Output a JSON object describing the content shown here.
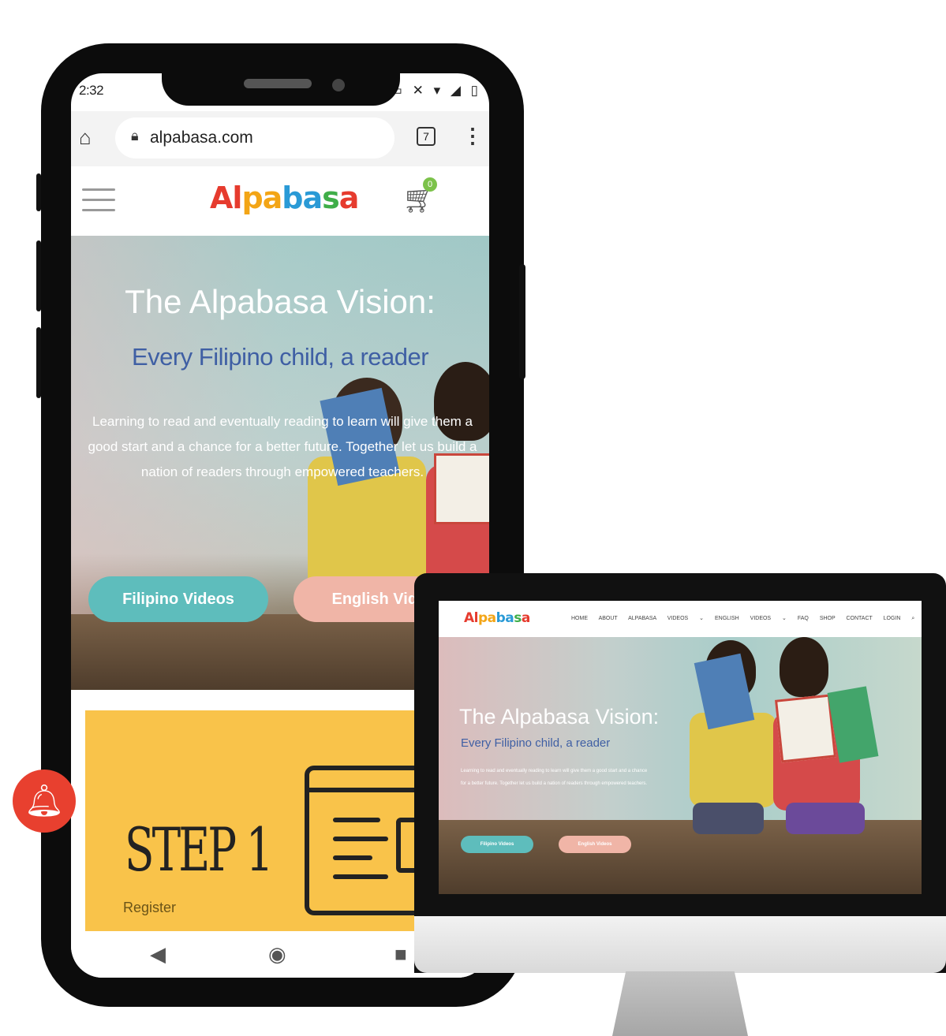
{
  "phone": {
    "status": {
      "time": "2:32",
      "icons": "⊖ ▭ ✕ ▾ ◢ ▯"
    },
    "browser": {
      "url": "alpabasa.com",
      "tab_count": "7"
    },
    "site": {
      "logo": [
        "Al",
        "pa",
        "ba",
        "s",
        "a"
      ],
      "cart_count": "0"
    },
    "hero": {
      "title": "The Alpabasa Vision:",
      "subtitle": "Every Filipino child, a reader",
      "body": "Learning to read and eventually reading to learn will give them a good start and a chance for a better future. Together let us build a nation of readers through empowered teachers.",
      "btn_filipino": "Filipino Videos",
      "btn_english": "English Videos"
    },
    "step": {
      "title": "STEP 1",
      "caption": "Register"
    }
  },
  "desktop": {
    "logo": "Alpabasa",
    "nav": [
      "HOME",
      "ABOUT",
      "ALPABASA VIDEOS ⌄",
      "ENGLISH VIDEOS ⌄",
      "FAQ",
      "SHOP",
      "CONTACT",
      "LOGIN"
    ],
    "hero": {
      "title": "The Alpabasa Vision:",
      "subtitle": "Every Filipino child, a reader",
      "body": "Learning to read and eventually reading to learn will give them a good start and a chance for a better future. Together let us build a nation of readers through empowered teachers.",
      "btn_filipino": "Filipino Videos",
      "btn_english": "English Videos"
    }
  }
}
